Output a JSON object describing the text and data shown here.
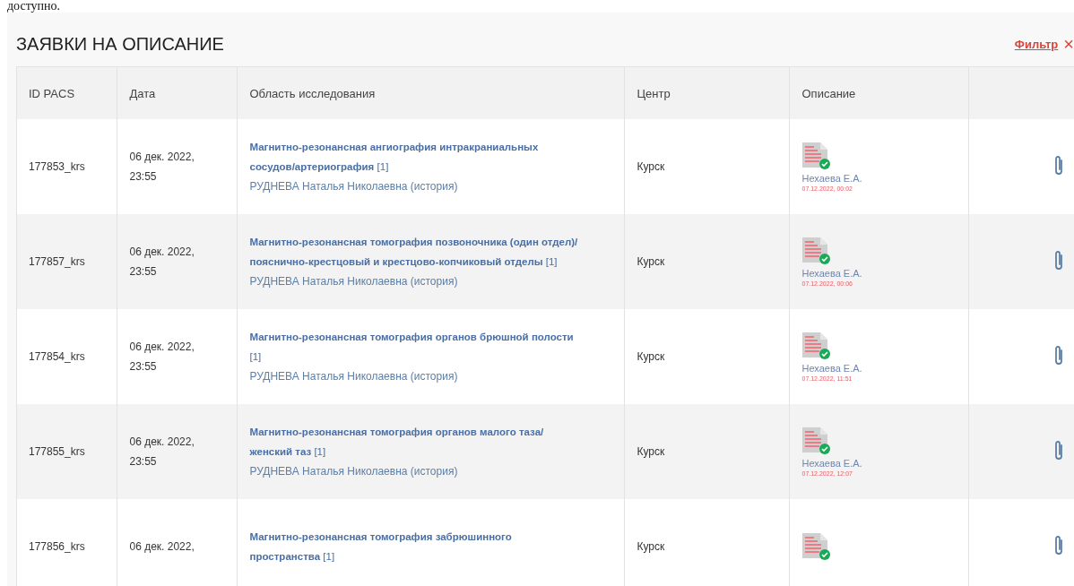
{
  "top_text": "доступно.",
  "panel": {
    "title": "ЗАЯВКИ НА ОПИСАНИЕ",
    "filter_link": "Фильтр",
    "clear_symbol": "×"
  },
  "table": {
    "columns": [
      "ID PACS",
      "Дата",
      "Область исследования",
      "Центр",
      "Описание"
    ],
    "rows": [
      {
        "id": "177853_krs",
        "date": [
          "06 дек. 2022,",
          "23:55"
        ],
        "study": "**Магнитно-резонансная ангиография интракраниальных сосудов/артериография** [1]",
        "patient": "РУДНЕВА Наталья Николаевна (история)",
        "center": "Курск",
        "author": "Нехаева Е.А.",
        "described_at": "07.12.2022, 00:02"
      },
      {
        "id": "177857_krs",
        "date": [
          "06 дек. 2022,",
          "23:55"
        ],
        "study": "**Магнитно-резонансная томография позвоночника (один отдел)/пояснично-крестцовый и крестцово-копчиковый отделы** [1]",
        "patient": "РУДНЕВА Наталья Николаевна (история)",
        "center": "Курск",
        "author": "Нехаева Е.А.",
        "described_at": "07.12.2022, 00:06"
      },
      {
        "id": "177854_krs",
        "date": [
          "06 дек. 2022,",
          "23:55"
        ],
        "study": "**Магнитно-резонансная томография органов брюшной полости** [1]",
        "patient": "РУДНЕВА Наталья Николаевна (история)",
        "center": "Курск",
        "author": "Нехаева Е.А.",
        "described_at": "07.12.2022, 11:51"
      },
      {
        "id": "177855_krs",
        "date": [
          "06 дек. 2022,",
          "23:55"
        ],
        "study": "**Магнитно-резонансная томография органов малого таза/ женский таз** [1]",
        "patient": "РУДНЕВА Наталья Николаевна (история)",
        "center": "Курск",
        "author": "Нехаева Е.А.",
        "described_at": "07.12.2022, 12:07"
      },
      {
        "id": "177856_krs",
        "date": [
          "06 дек. 2022,"
        ],
        "study": "**Магнитно-резонансная томография забрюшинного пространства** [1]",
        "center": "Курск"
      }
    ]
  }
}
